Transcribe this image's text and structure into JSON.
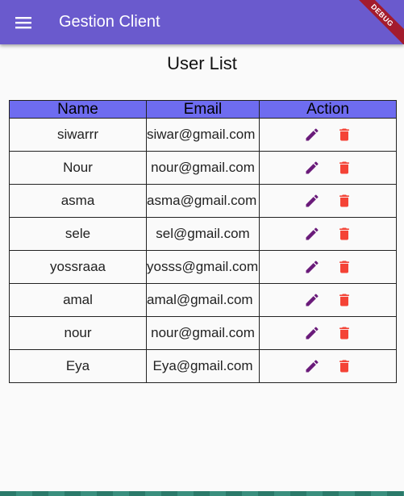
{
  "appbar": {
    "title": "Gestion Client",
    "menu_icon": "menu-icon",
    "debug_label": "DEBUG",
    "color": "#6a5acd"
  },
  "page": {
    "title": "User List"
  },
  "table": {
    "headers": {
      "name": "Name",
      "email": "Email",
      "action": "Action"
    },
    "header_color": "#6e6cf0",
    "rows": [
      {
        "name": "siwarrr",
        "email": "siwar@gmail.com"
      },
      {
        "name": "Nour",
        "email": "nour@gmail.com"
      },
      {
        "name": "asma",
        "email": "asma@gmail.com"
      },
      {
        "name": "sele",
        "email": "sel@gmail.com"
      },
      {
        "name": "yossraaa",
        "email": "yosss@gmail.com"
      },
      {
        "name": "amal",
        "email": "amal@gmail.com"
      },
      {
        "name": "nour",
        "email": "nour@gmail.com"
      },
      {
        "name": "Eya",
        "email": "Eya@gmail.com"
      }
    ],
    "edit_icon": "pencil-icon",
    "delete_icon": "trash-icon",
    "edit_color": "#6a1b7a",
    "delete_color": "#f44336"
  }
}
